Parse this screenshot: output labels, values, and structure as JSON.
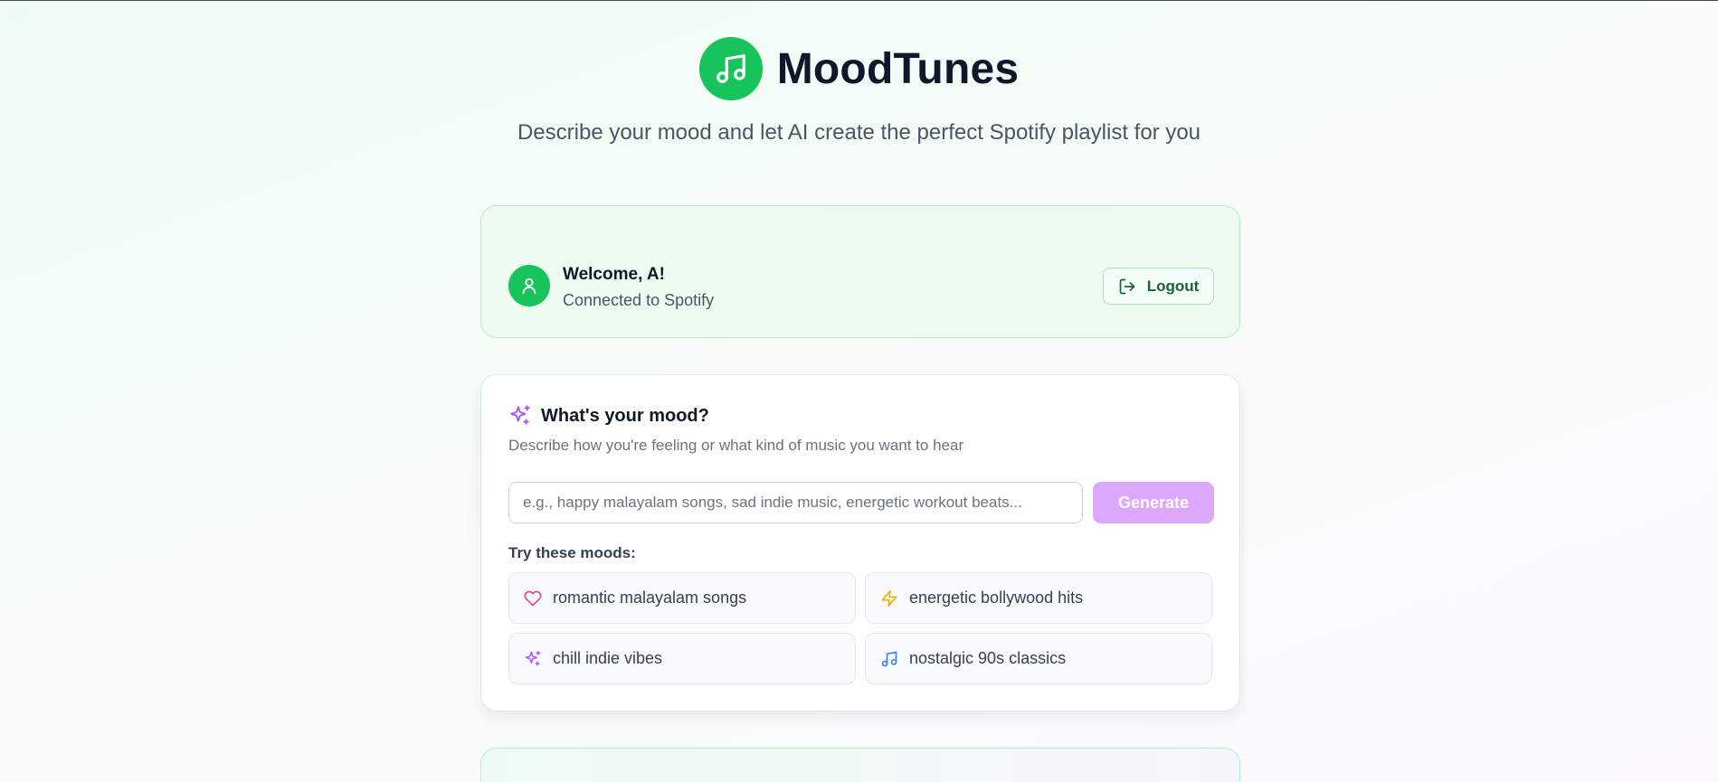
{
  "header": {
    "app_title": "MoodTunes",
    "tagline": "Describe your mood and let AI create the perfect Spotify playlist for you",
    "logo_icon": "music-note-icon",
    "brand_color": "#16c45b"
  },
  "welcome": {
    "title": "Welcome, A!",
    "subtitle": "Connected to Spotify",
    "avatar_icon": "user-icon",
    "logout_label": "Logout",
    "logout_icon": "logout-icon"
  },
  "mood": {
    "title": "What's your mood?",
    "title_icon": "sparkles-icon",
    "description": "Describe how you're feeling or what kind of music you want to hear",
    "input_value": "",
    "input_placeholder": "e.g., happy malayalam songs, sad indie music, energetic workout beats...",
    "generate_label": "Generate",
    "accent_color": "#dba8fb",
    "try_label": "Try these moods:",
    "suggestions": [
      {
        "label": "romantic malayalam songs",
        "icon": "heart-icon",
        "icon_color": "#ec4899"
      },
      {
        "label": "energetic bollywood hits",
        "icon": "lightning-icon",
        "icon_color": "#eab308"
      },
      {
        "label": "chill indie vibes",
        "icon": "sparkles-icon",
        "icon_color": "#a855f7"
      },
      {
        "label": "nostalgic 90s classics",
        "icon": "music-note-icon",
        "icon_color": "#3b82f6"
      }
    ]
  }
}
